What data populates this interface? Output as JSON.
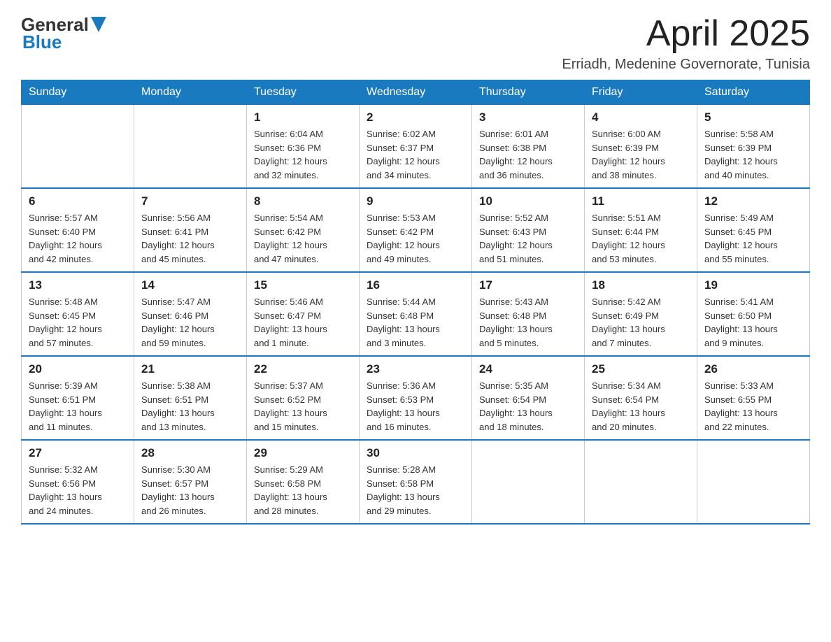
{
  "logo": {
    "text_general": "General",
    "text_blue": "Blue"
  },
  "title": "April 2025",
  "subtitle": "Erriadh, Medenine Governorate, Tunisia",
  "days_of_week": [
    "Sunday",
    "Monday",
    "Tuesday",
    "Wednesday",
    "Thursday",
    "Friday",
    "Saturday"
  ],
  "weeks": [
    [
      {
        "day": "",
        "info": ""
      },
      {
        "day": "",
        "info": ""
      },
      {
        "day": "1",
        "info": "Sunrise: 6:04 AM\nSunset: 6:36 PM\nDaylight: 12 hours\nand 32 minutes."
      },
      {
        "day": "2",
        "info": "Sunrise: 6:02 AM\nSunset: 6:37 PM\nDaylight: 12 hours\nand 34 minutes."
      },
      {
        "day": "3",
        "info": "Sunrise: 6:01 AM\nSunset: 6:38 PM\nDaylight: 12 hours\nand 36 minutes."
      },
      {
        "day": "4",
        "info": "Sunrise: 6:00 AM\nSunset: 6:39 PM\nDaylight: 12 hours\nand 38 minutes."
      },
      {
        "day": "5",
        "info": "Sunrise: 5:58 AM\nSunset: 6:39 PM\nDaylight: 12 hours\nand 40 minutes."
      }
    ],
    [
      {
        "day": "6",
        "info": "Sunrise: 5:57 AM\nSunset: 6:40 PM\nDaylight: 12 hours\nand 42 minutes."
      },
      {
        "day": "7",
        "info": "Sunrise: 5:56 AM\nSunset: 6:41 PM\nDaylight: 12 hours\nand 45 minutes."
      },
      {
        "day": "8",
        "info": "Sunrise: 5:54 AM\nSunset: 6:42 PM\nDaylight: 12 hours\nand 47 minutes."
      },
      {
        "day": "9",
        "info": "Sunrise: 5:53 AM\nSunset: 6:42 PM\nDaylight: 12 hours\nand 49 minutes."
      },
      {
        "day": "10",
        "info": "Sunrise: 5:52 AM\nSunset: 6:43 PM\nDaylight: 12 hours\nand 51 minutes."
      },
      {
        "day": "11",
        "info": "Sunrise: 5:51 AM\nSunset: 6:44 PM\nDaylight: 12 hours\nand 53 minutes."
      },
      {
        "day": "12",
        "info": "Sunrise: 5:49 AM\nSunset: 6:45 PM\nDaylight: 12 hours\nand 55 minutes."
      }
    ],
    [
      {
        "day": "13",
        "info": "Sunrise: 5:48 AM\nSunset: 6:45 PM\nDaylight: 12 hours\nand 57 minutes."
      },
      {
        "day": "14",
        "info": "Sunrise: 5:47 AM\nSunset: 6:46 PM\nDaylight: 12 hours\nand 59 minutes."
      },
      {
        "day": "15",
        "info": "Sunrise: 5:46 AM\nSunset: 6:47 PM\nDaylight: 13 hours\nand 1 minute."
      },
      {
        "day": "16",
        "info": "Sunrise: 5:44 AM\nSunset: 6:48 PM\nDaylight: 13 hours\nand 3 minutes."
      },
      {
        "day": "17",
        "info": "Sunrise: 5:43 AM\nSunset: 6:48 PM\nDaylight: 13 hours\nand 5 minutes."
      },
      {
        "day": "18",
        "info": "Sunrise: 5:42 AM\nSunset: 6:49 PM\nDaylight: 13 hours\nand 7 minutes."
      },
      {
        "day": "19",
        "info": "Sunrise: 5:41 AM\nSunset: 6:50 PM\nDaylight: 13 hours\nand 9 minutes."
      }
    ],
    [
      {
        "day": "20",
        "info": "Sunrise: 5:39 AM\nSunset: 6:51 PM\nDaylight: 13 hours\nand 11 minutes."
      },
      {
        "day": "21",
        "info": "Sunrise: 5:38 AM\nSunset: 6:51 PM\nDaylight: 13 hours\nand 13 minutes."
      },
      {
        "day": "22",
        "info": "Sunrise: 5:37 AM\nSunset: 6:52 PM\nDaylight: 13 hours\nand 15 minutes."
      },
      {
        "day": "23",
        "info": "Sunrise: 5:36 AM\nSunset: 6:53 PM\nDaylight: 13 hours\nand 16 minutes."
      },
      {
        "day": "24",
        "info": "Sunrise: 5:35 AM\nSunset: 6:54 PM\nDaylight: 13 hours\nand 18 minutes."
      },
      {
        "day": "25",
        "info": "Sunrise: 5:34 AM\nSunset: 6:54 PM\nDaylight: 13 hours\nand 20 minutes."
      },
      {
        "day": "26",
        "info": "Sunrise: 5:33 AM\nSunset: 6:55 PM\nDaylight: 13 hours\nand 22 minutes."
      }
    ],
    [
      {
        "day": "27",
        "info": "Sunrise: 5:32 AM\nSunset: 6:56 PM\nDaylight: 13 hours\nand 24 minutes."
      },
      {
        "day": "28",
        "info": "Sunrise: 5:30 AM\nSunset: 6:57 PM\nDaylight: 13 hours\nand 26 minutes."
      },
      {
        "day": "29",
        "info": "Sunrise: 5:29 AM\nSunset: 6:58 PM\nDaylight: 13 hours\nand 28 minutes."
      },
      {
        "day": "30",
        "info": "Sunrise: 5:28 AM\nSunset: 6:58 PM\nDaylight: 13 hours\nand 29 minutes."
      },
      {
        "day": "",
        "info": ""
      },
      {
        "day": "",
        "info": ""
      },
      {
        "day": "",
        "info": ""
      }
    ]
  ]
}
